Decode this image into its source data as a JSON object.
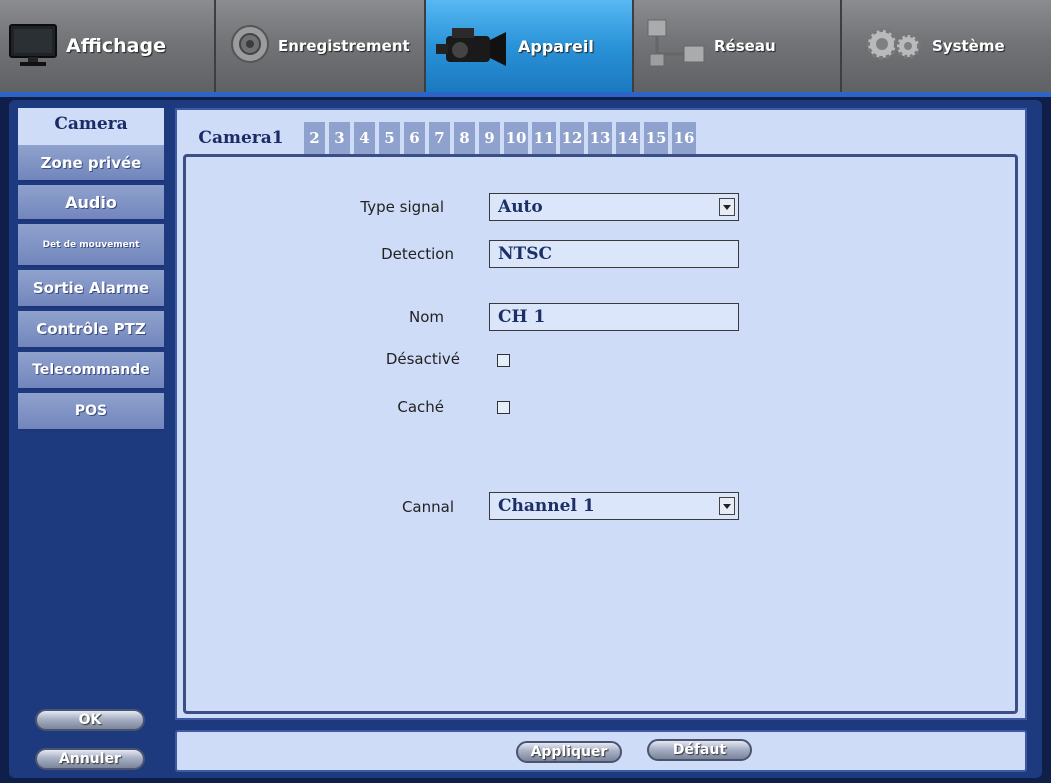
{
  "topnav": {
    "tabs": [
      {
        "label": "Affichage",
        "icon": "monitor-icon"
      },
      {
        "label": "Enregistrement",
        "icon": "camera-lens-icon"
      },
      {
        "label": "Appareil",
        "icon": "camcorder-icon"
      },
      {
        "label": "Réseau",
        "icon": "network-icon"
      },
      {
        "label": "Système",
        "icon": "gear-icon"
      }
    ],
    "active_tab": "Appareil"
  },
  "sidebar": {
    "items": [
      {
        "label": "Camera"
      },
      {
        "label": "Zone privée"
      },
      {
        "label": "Audio"
      },
      {
        "label": "Det de mouvement"
      },
      {
        "label": "Sortie Alarme"
      },
      {
        "label": "Contrôle PTZ"
      },
      {
        "label": "Telecommande"
      },
      {
        "label": "POS"
      }
    ],
    "ok_label": "OK",
    "cancel_label": "Annuler"
  },
  "camera_tabs": [
    "Camera1",
    "2",
    "3",
    "4",
    "5",
    "6",
    "7",
    "8",
    "9",
    "10",
    "11",
    "12",
    "13",
    "14",
    "15",
    "16"
  ],
  "form": {
    "signal_type": {
      "label": "Type signal",
      "value": "Auto"
    },
    "detection": {
      "label": "Detection",
      "value": "NTSC"
    },
    "name": {
      "label": "Nom",
      "value": "CH 1"
    },
    "disabled": {
      "label": "Désactivé",
      "checked": false
    },
    "hidden": {
      "label": "Caché",
      "checked": false
    },
    "channel": {
      "label": "Cannal",
      "value": "Channel 1"
    }
  },
  "actions": {
    "apply_label": "Appliquer",
    "default_label": "Défaut"
  },
  "colors": {
    "active_nav": "#2a93d8",
    "panel_bg": "#cfdcf8",
    "menu_bg": "#7286bd",
    "frame": "#1e3a7e"
  }
}
